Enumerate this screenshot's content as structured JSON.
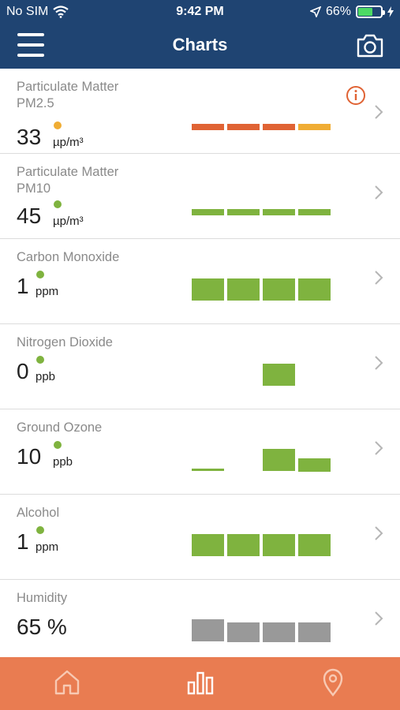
{
  "status": {
    "carrier": "No SIM",
    "time": "9:42 PM",
    "battery": "66%",
    "battery_level": 0.66
  },
  "header": {
    "title": "Charts"
  },
  "colors": {
    "nav_bg": "#1f4472",
    "tab_bg": "#e97c51",
    "red": "#e06334",
    "amber": "#f0ad34",
    "green": "#7fb33f",
    "gray": "#999999"
  },
  "rows": [
    {
      "name": "Particulate Matter PM2.5",
      "value": "33",
      "unit": "µp/m³",
      "dot": "amber",
      "info": true,
      "bars": [
        {
          "color": "red",
          "level": "thin"
        },
        {
          "color": "red",
          "level": "thin"
        },
        {
          "color": "red",
          "level": "thin"
        },
        {
          "color": "amber",
          "level": "thin"
        }
      ]
    },
    {
      "name": "Particulate Matter PM10",
      "value": "45",
      "unit": "µp/m³",
      "dot": "green",
      "info": false,
      "bars": [
        {
          "color": "green",
          "level": "thin"
        },
        {
          "color": "green",
          "level": "thin"
        },
        {
          "color": "green",
          "level": "thin"
        },
        {
          "color": "green",
          "level": "thin"
        }
      ]
    },
    {
      "name": "Carbon Monoxide",
      "value": "1",
      "unit": "ppm",
      "dot": "green",
      "info": false,
      "bars": [
        {
          "color": "green",
          "level": "full"
        },
        {
          "color": "green",
          "level": "full"
        },
        {
          "color": "green",
          "level": "full"
        },
        {
          "color": "green",
          "level": "full"
        }
      ]
    },
    {
      "name": "Nitrogen Dioxide",
      "value": "0",
      "unit": "ppb",
      "dot": "green",
      "info": false,
      "bars": [
        null,
        null,
        {
          "color": "green",
          "level": "full"
        },
        null
      ]
    },
    {
      "name": "Ground Ozone",
      "value": "10",
      "unit": "ppb",
      "dot": "green",
      "info": false,
      "bars": [
        {
          "color": "green",
          "level": "line"
        },
        null,
        {
          "color": "green",
          "level": "full"
        },
        {
          "color": "green",
          "level": "half"
        }
      ]
    },
    {
      "name": "Alcohol",
      "value": "1",
      "unit": "ppm",
      "dot": "green",
      "info": false,
      "bars": [
        {
          "color": "green",
          "level": "full"
        },
        {
          "color": "green",
          "level": "full"
        },
        {
          "color": "green",
          "level": "full"
        },
        {
          "color": "green",
          "level": "full"
        }
      ]
    },
    {
      "name": "Humidity",
      "value": "65 %",
      "unit": "",
      "dot": null,
      "info": false,
      "bars": [
        {
          "color": "gray",
          "level": "full"
        },
        {
          "color": "gray",
          "level": "mid"
        },
        {
          "color": "gray",
          "level": "mid"
        },
        {
          "color": "gray",
          "level": "mid"
        }
      ]
    }
  ],
  "tabs": [
    {
      "icon": "home-icon"
    },
    {
      "icon": "bar-chart-icon"
    },
    {
      "icon": "location-pin-icon"
    }
  ]
}
